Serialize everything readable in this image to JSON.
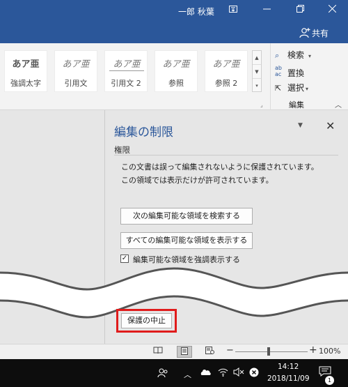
{
  "titlebar": {
    "user": "一郎 秋葉",
    "bg": "#2b579a"
  },
  "share": {
    "label": "共有"
  },
  "ribbon": {
    "styles": [
      {
        "sample": "あア亜",
        "label": "強調太字"
      },
      {
        "sample": "あア亜",
        "label": "引用文"
      },
      {
        "sample": "あア亜",
        "label": "引用文 2"
      },
      {
        "sample": "あア亜",
        "label": "参照"
      },
      {
        "sample": "あア亜",
        "label": "参照 2"
      }
    ],
    "editing": {
      "find": "検索",
      "replace": "置換",
      "select": "選択",
      "group_label": "編集"
    }
  },
  "pane": {
    "title": "編集の制限",
    "section": "権限",
    "message_1": "この文書は誤って編集されないように保護されています。",
    "message_2": "この領域では表示だけが許可されています。",
    "find_next_btn": "次の編集可能な領域を検索する",
    "show_all_btn": "すべての編集可能な領域を表示する",
    "highlight_label": "編集可能な領域を強調表示する",
    "highlight_checked": true,
    "stop_btn": "保護の中止"
  },
  "statusbar": {
    "zoom": "100%"
  },
  "taskbar": {
    "time": "14:12",
    "date": "2018/11/09",
    "notifications": "1"
  },
  "colors": {
    "accent": "#2b579a",
    "highlight_box": "#e01b1b"
  }
}
